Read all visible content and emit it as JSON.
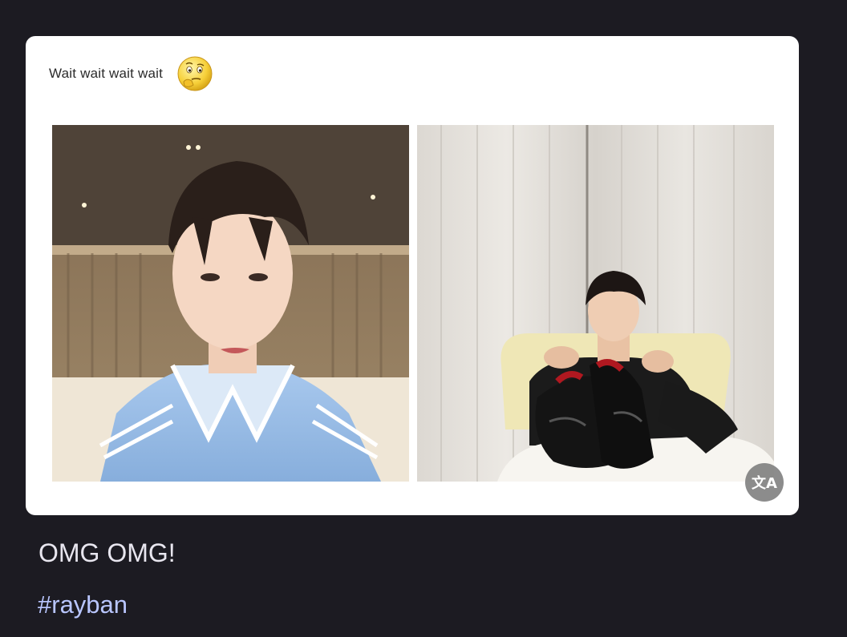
{
  "post": {
    "header_text": "Wait wait wait wait",
    "emoji_icon": "thinking-face-icon",
    "caption": "OMG OMG!",
    "hashtag": "#rayban"
  },
  "photos": {
    "left_icon": "photo-person-blue-shirt",
    "right_icon": "photo-person-holding-shoes"
  },
  "controls": {
    "translate_icon": "translate-icon",
    "translate_glyph": "文A"
  },
  "colors": {
    "background": "#1c1b22",
    "card": "#ffffff",
    "hashtag": "#b9c6ff",
    "caption": "#e8e6ef"
  }
}
